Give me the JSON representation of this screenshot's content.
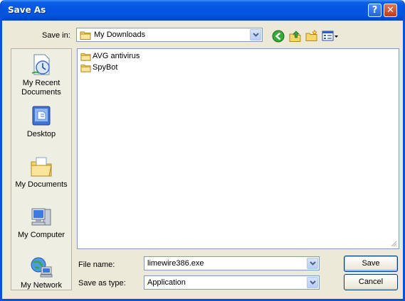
{
  "window": {
    "title": "Save As",
    "help_glyph": "?",
    "close_glyph": "✕"
  },
  "toolbar": {
    "save_in_label": "Save in:",
    "save_in_value": "My Downloads",
    "icons": [
      "back-icon",
      "up-one-level-icon",
      "new-folder-icon",
      "views-menu-icon"
    ]
  },
  "places": [
    {
      "label": "My Recent Documents",
      "icon": "recent-documents-icon"
    },
    {
      "label": "Desktop",
      "icon": "desktop-icon"
    },
    {
      "label": "My Documents",
      "icon": "my-documents-icon"
    },
    {
      "label": "My Computer",
      "icon": "my-computer-icon"
    },
    {
      "label": "My Network",
      "icon": "my-network-icon"
    }
  ],
  "files": [
    {
      "name": "AVG antivirus",
      "icon": "folder-icon"
    },
    {
      "name": "SpyBot",
      "icon": "folder-icon"
    }
  ],
  "form": {
    "file_name_label": "File name:",
    "file_name_value": "limewire386.exe",
    "save_as_type_label": "Save as type:",
    "save_as_type_value": "Application"
  },
  "buttons": {
    "save": "Save",
    "cancel": "Cancel"
  },
  "colors": {
    "titlebar": "#0556e3",
    "window_bg": "#ece9d8",
    "close": "#c2391a"
  }
}
